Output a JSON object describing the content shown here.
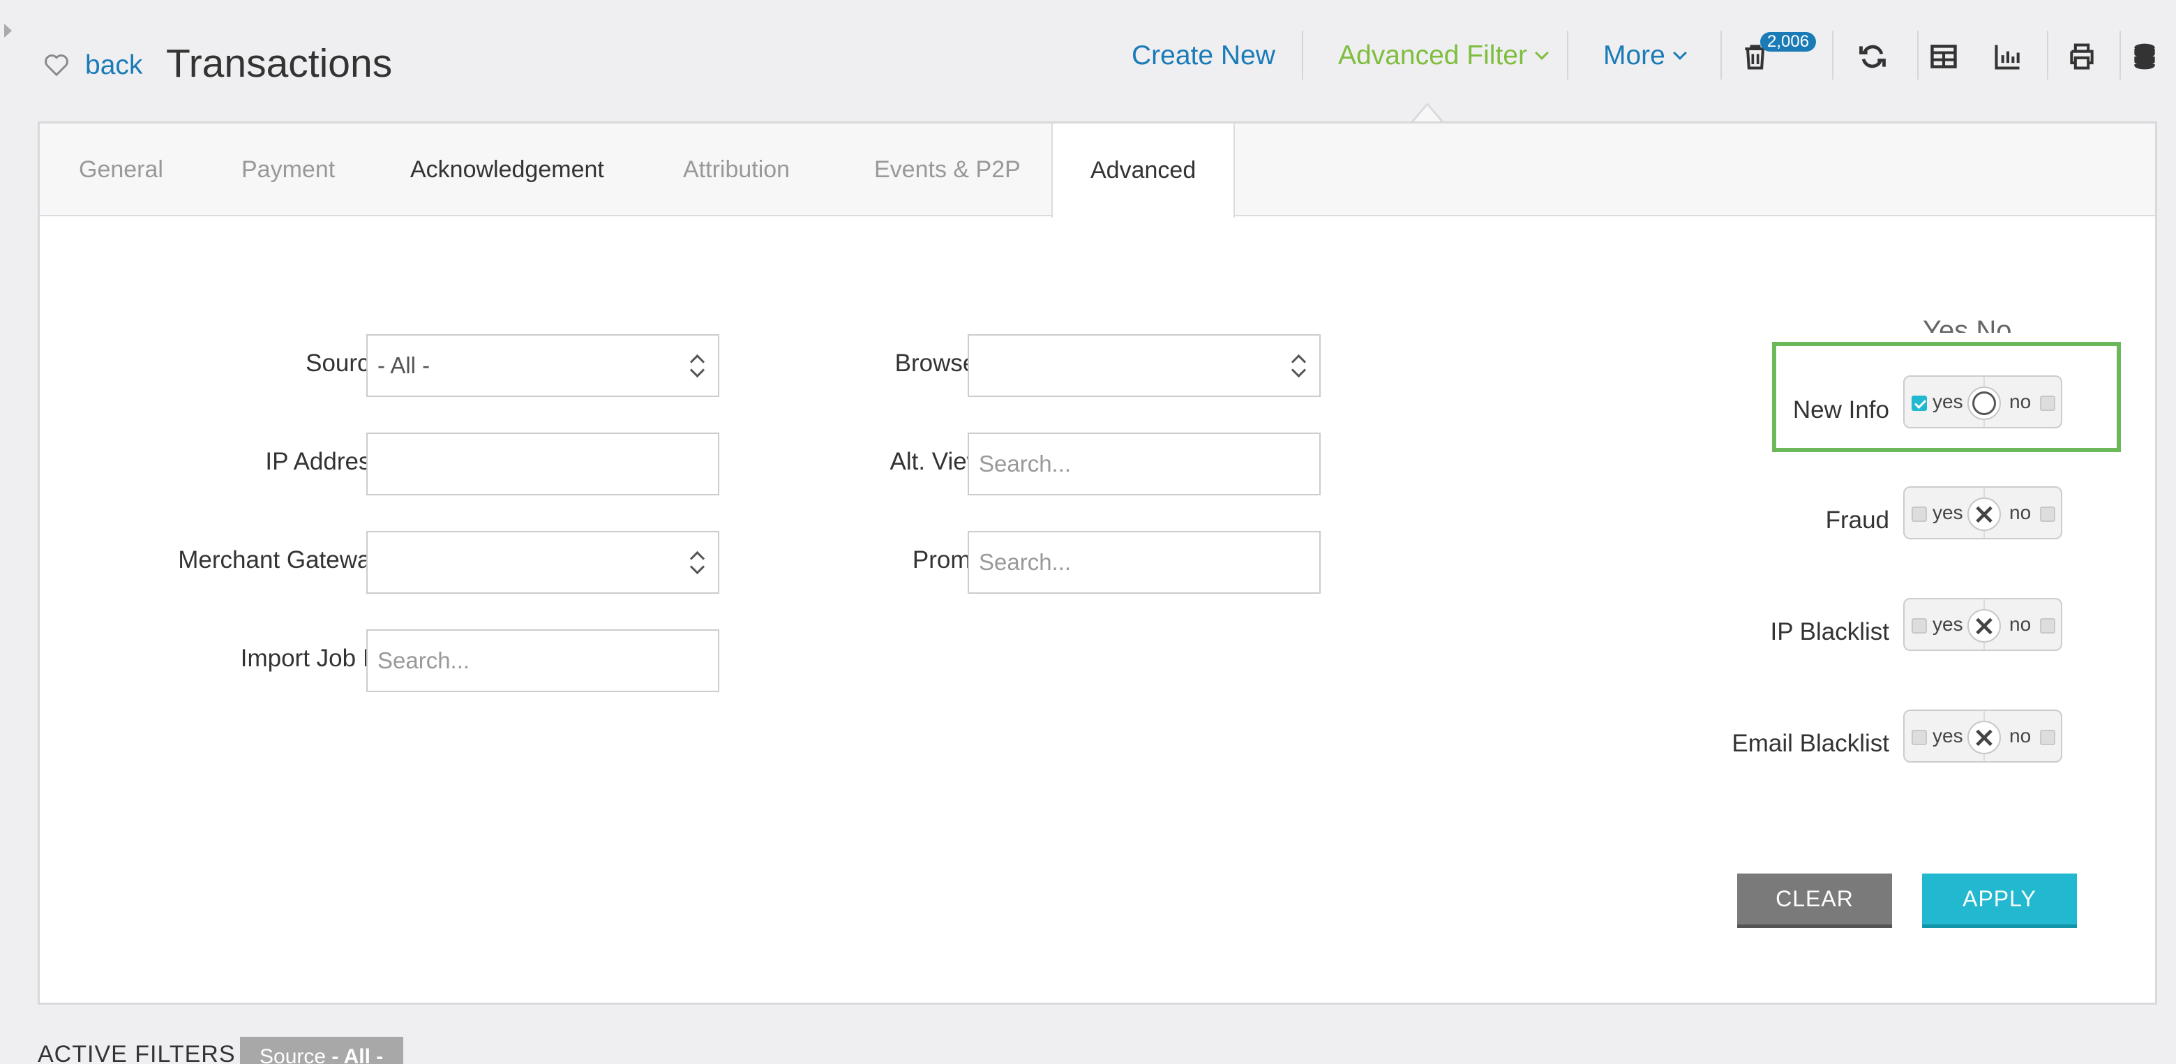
{
  "header": {
    "back_label": "back",
    "title": "Transactions",
    "create_new": "Create New",
    "advanced_filter": "Advanced Filter",
    "more": "More",
    "trash_count": "2,006"
  },
  "tabs": [
    {
      "label": "General"
    },
    {
      "label": "Payment"
    },
    {
      "label": "Acknowledgement"
    },
    {
      "label": "Attribution"
    },
    {
      "label": "Events & P2P"
    },
    {
      "label": "Advanced"
    }
  ],
  "filters": {
    "source": {
      "label": "Source",
      "value": "- All -"
    },
    "ip_address": {
      "label": "IP Address",
      "value": ""
    },
    "merchant_gateway": {
      "label": "Merchant Gateway",
      "value": ""
    },
    "import_job_id": {
      "label": "Import Job Id",
      "placeholder": "Search..."
    },
    "browser": {
      "label": "Browser",
      "value": ""
    },
    "alt_view": {
      "label": "Alt. View",
      "placeholder": "Search..."
    },
    "promo": {
      "label": "Promo",
      "placeholder": "Search..."
    }
  },
  "toggles": {
    "heading": "Yes No",
    "yes_text": "yes",
    "no_text": "no",
    "items": [
      {
        "label": "New Info",
        "state": "neutral",
        "yes_checked": true
      },
      {
        "label": "Fraud",
        "state": "cleared",
        "yes_checked": false
      },
      {
        "label": "IP Blacklist",
        "state": "cleared",
        "yes_checked": false
      },
      {
        "label": "Email Blacklist",
        "state": "cleared",
        "yes_checked": false
      }
    ]
  },
  "buttons": {
    "clear": "CLEAR",
    "apply": "APPLY"
  },
  "active_filters": {
    "label": "ACTIVE FILTERS",
    "chip_name": "Source",
    "chip_value": "- All -"
  },
  "colors": {
    "link": "#1a7bb7",
    "filter_green": "#7fbd3f",
    "apply": "#22b8cf",
    "clear": "#7a7a7a",
    "highlight": "#6bb85a"
  }
}
